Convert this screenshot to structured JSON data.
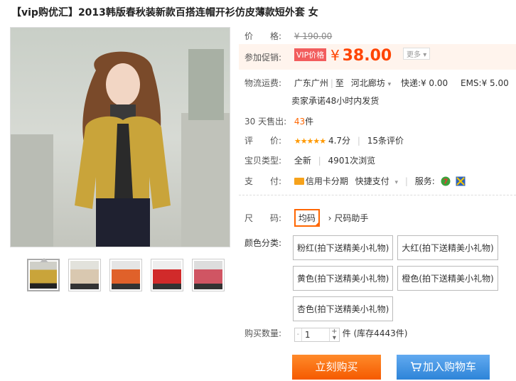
{
  "title": "【vip购优汇】2013韩版春秋装新款百搭连帽开衫仿皮薄款短外套 女",
  "price": {
    "label": "价　　格:",
    "original": "¥ 190.00"
  },
  "promo": {
    "label": "参加促销:",
    "tag": "VIP价格",
    "currency": "¥",
    "price": "38.00",
    "more": "更多"
  },
  "shipping": {
    "label": "物流运费:",
    "from": "广东广州",
    "to_prefix": "至",
    "to": "河北廊坊",
    "express": "快递:¥ 0.00",
    "ems": "EMS:¥ 5.00",
    "promise": "卖家承诺48小时内发货"
  },
  "sales": {
    "label": "30 天售出:",
    "count": "43",
    "unit": "件"
  },
  "rating": {
    "label": "评　　价:",
    "stars": "★★★★★",
    "score": "4.7分",
    "reviews": "15条评价"
  },
  "type": {
    "label": "宝贝类型:",
    "condition": "全新",
    "views": "4901次浏览"
  },
  "payment": {
    "label": "支　　付:",
    "credit": "信用卡分期",
    "quick": "快捷支付",
    "service_label": "服务:"
  },
  "size": {
    "label": "尺　　码:",
    "selected": "均码",
    "helper": "尺码助手"
  },
  "color": {
    "label": "颜色分类:",
    "options": [
      "粉红(拍下送精美小礼物)",
      "大红(拍下送精美小礼物)",
      "黄色(拍下送精美小礼物)",
      "橙色(拍下送精美小礼物)",
      "杏色(拍下送精美小礼物)"
    ]
  },
  "quantity": {
    "label": "购买数量:",
    "value": "1",
    "unit": "件",
    "stock": "(库存4443件)"
  },
  "buttons": {
    "buy": "立刻购买",
    "cart": "加入购物车"
  },
  "colors_theme": {
    "accent": "#ff4400",
    "buy": "#f55a00",
    "cart": "#2d84d8"
  }
}
